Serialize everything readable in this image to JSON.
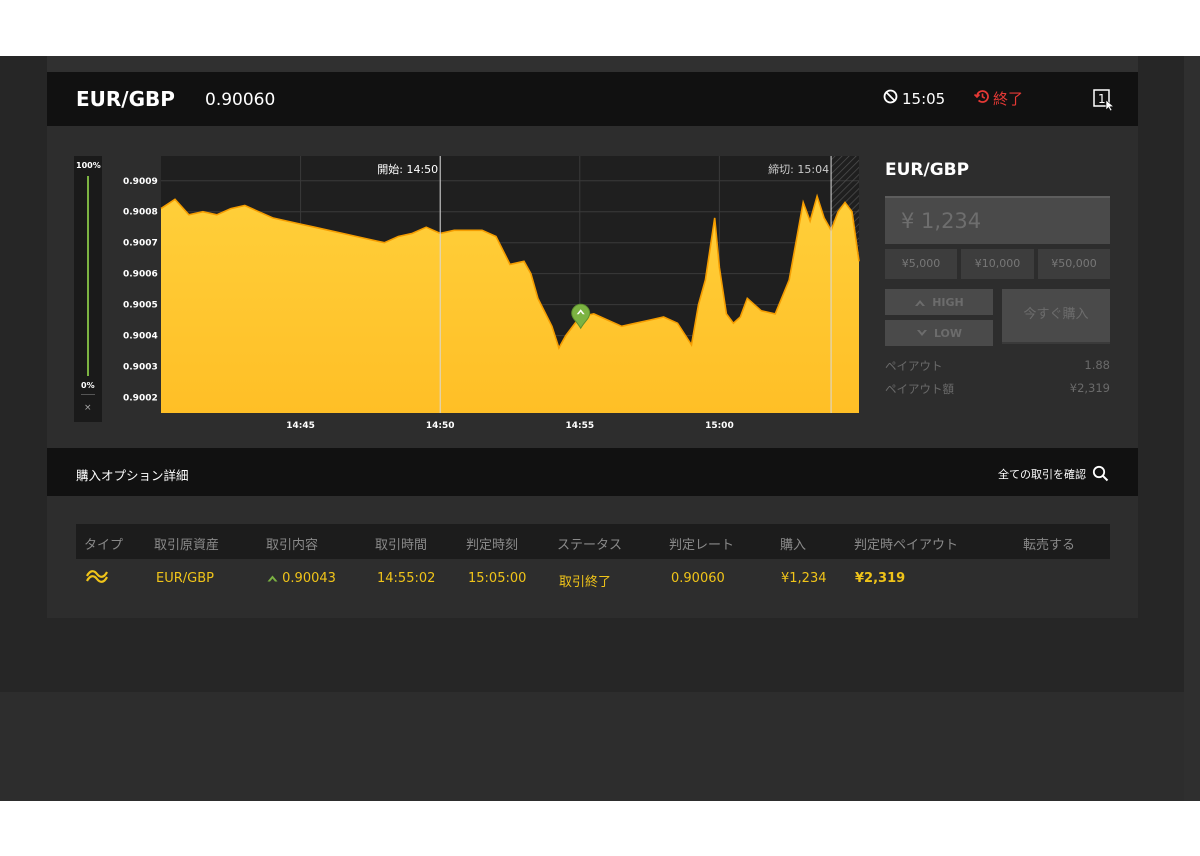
{
  "header": {
    "pair": "EUR/GBP",
    "rate": "0.90060",
    "timer": "15:05",
    "status": "終了",
    "monitor_glyph": "1"
  },
  "side_panel": {
    "pair": "EUR/GBP",
    "amount": "¥ 1,234",
    "presets": [
      "¥5,000",
      "¥10,000",
      "¥50,000"
    ],
    "high_label": "HIGH",
    "low_label": "LOW",
    "buy_label": "今すぐ購入",
    "payout_label": "ペイアウト",
    "payout_value": "1.88",
    "payout_amount_label": "ペイアウト額",
    "payout_amount_value": "¥2,319"
  },
  "level_bar": {
    "top_label": "100%",
    "bottom_label": "0%",
    "close_glyph": "×",
    "level": 1.0
  },
  "chart_data": {
    "type": "area",
    "pair": "EUR/GBP",
    "ylim": [
      0.90015,
      0.90098
    ],
    "y_ticks": [
      "0.9009",
      "0.9008",
      "0.9007",
      "0.9006",
      "0.9005",
      "0.9004",
      "0.9003",
      "0.9002"
    ],
    "x_ticks": [
      "14:45",
      "14:50",
      "14:55",
      "15:00"
    ],
    "start_label": "開始: 14:50",
    "deadline_label": "締切: 15:04",
    "entry_marker": {
      "time": "14:55:02",
      "value": 0.90043
    },
    "color": "#ffc72c",
    "times": [
      "14:40:00",
      "14:40:30",
      "14:41:00",
      "14:41:30",
      "14:42:00",
      "14:42:30",
      "14:43:00",
      "14:43:30",
      "14:44:00",
      "14:44:30",
      "14:45:00",
      "14:45:30",
      "14:46:00",
      "14:46:30",
      "14:47:00",
      "14:47:30",
      "14:48:00",
      "14:48:30",
      "14:49:00",
      "14:49:30",
      "14:50:00",
      "14:50:30",
      "14:51:00",
      "14:51:30",
      "14:52:00",
      "14:52:30",
      "14:53:00",
      "14:53:15",
      "14:53:30",
      "14:54:00",
      "14:54:15",
      "14:54:30",
      "14:55:00",
      "14:55:30",
      "14:56:00",
      "14:56:30",
      "14:57:00",
      "14:57:30",
      "14:58:00",
      "14:58:30",
      "14:59:00",
      "14:59:15",
      "14:59:30",
      "14:59:50",
      "15:00:00",
      "15:00:15",
      "15:00:30",
      "15:00:45",
      "15:01:00",
      "15:01:30",
      "15:02:00",
      "15:02:30",
      "15:03:00",
      "15:03:15",
      "15:03:30",
      "15:03:45",
      "15:04:00",
      "15:04:15",
      "15:04:30",
      "15:04:45",
      "15:05:00"
    ],
    "values": [
      0.90081,
      0.90084,
      0.90079,
      0.9008,
      0.90079,
      0.90081,
      0.90082,
      0.9008,
      0.90078,
      0.90077,
      0.90076,
      0.90075,
      0.90074,
      0.90073,
      0.90072,
      0.90071,
      0.9007,
      0.90072,
      0.90073,
      0.90075,
      0.90073,
      0.90074,
      0.90074,
      0.90074,
      0.90072,
      0.90063,
      0.90064,
      0.9006,
      0.90052,
      0.90043,
      0.90036,
      0.9004,
      0.90046,
      0.90047,
      0.90045,
      0.90043,
      0.90044,
      0.90045,
      0.90046,
      0.90044,
      0.90037,
      0.9005,
      0.90058,
      0.90078,
      0.90062,
      0.90047,
      0.90044,
      0.90046,
      0.90052,
      0.90048,
      0.90047,
      0.90058,
      0.90083,
      0.90077,
      0.90085,
      0.90078,
      0.90074,
      0.9008,
      0.90083,
      0.9008,
      0.90064
    ]
  },
  "details": {
    "title": "購入オプション詳細",
    "all_trades_link": "全ての取引を確認",
    "columns": [
      "タイプ",
      "取引原資産",
      "取引内容",
      "取引時間",
      "判定時刻",
      "ステータス",
      "判定レート",
      "購入",
      "判定時ペイアウト",
      "転売する"
    ],
    "row": {
      "type_icon": "high-low-icon",
      "asset": "EUR/GBP",
      "content": "0.90043",
      "trade_time": "14:55:02",
      "judgment_time": "15:05:00",
      "status": "取引終了",
      "judgment_rate": "0.90060",
      "purchase": "¥1,234",
      "payout": "¥2,319"
    }
  }
}
